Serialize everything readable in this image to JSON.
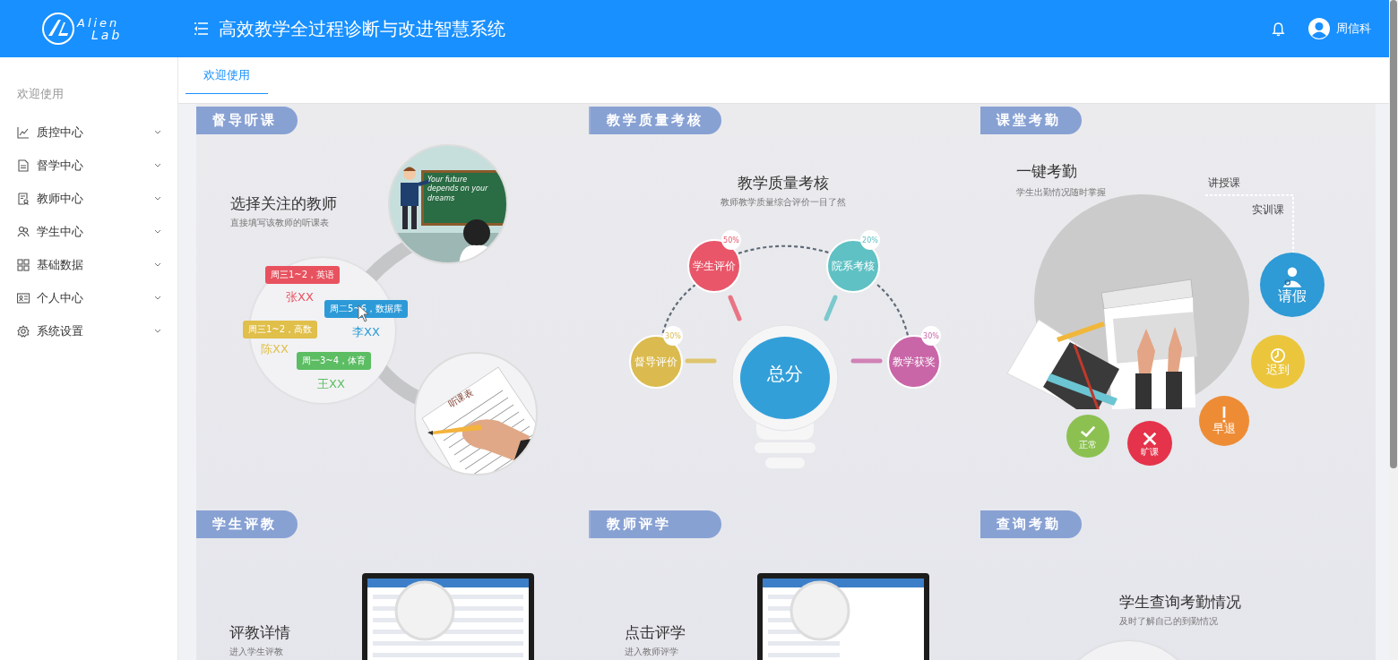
{
  "header": {
    "logo": [
      "Alien",
      "Lab"
    ],
    "title": "高效教学全过程诊断与改进智慧系统",
    "user": "周信科"
  },
  "sidebar": {
    "heading": "欢迎使用",
    "items": [
      {
        "label": "质控中心",
        "expanded": false
      },
      {
        "label": "督学中心",
        "expanded": false
      },
      {
        "label": "教师中心",
        "expanded": false
      },
      {
        "label": "学生中心",
        "expanded": false
      },
      {
        "label": "基础数据",
        "expanded": false
      },
      {
        "label": "个人中心",
        "expanded": false
      },
      {
        "label": "系统设置",
        "expanded": false
      }
    ]
  },
  "tabs": [
    {
      "label": "欢迎使用",
      "selected": true
    }
  ],
  "panels": [
    {
      "kind": "supervision",
      "tag": "督导听课",
      "title": "选择关注的教师",
      "subtitle": "直接填写该教师的听课表",
      "board_text": "Your future depends on your dreams",
      "sheet_title": "听课表",
      "bubbles": [
        {
          "text": "周三1~2，英语",
          "name": "张XX",
          "color": "#e8525f"
        },
        {
          "text": "周二5~6，数据库",
          "name": "李XX",
          "color": "#2d9ad8"
        },
        {
          "text": "周三1~2，高数",
          "name": "陈XX",
          "color": "#e0bf4a"
        },
        {
          "text": "周一3~4，体育",
          "name": "王XX",
          "color": "#5cbd63"
        }
      ]
    },
    {
      "kind": "quality",
      "tag": "教学质量考核",
      "title": "教学质量考核",
      "subtitle": "教师教学质量综合评价一目了然",
      "center": "总分",
      "nodes": [
        {
          "label": "学生评价",
          "share": "50%",
          "color": "#e9566a"
        },
        {
          "label": "院系考核",
          "share": "20%",
          "color": "#5fc1c4"
        },
        {
          "label": "督导评价",
          "share": "30%",
          "color": "#dbbb4f"
        },
        {
          "label": "教学获奖",
          "share": "30%",
          "color": "#c966a8"
        }
      ]
    },
    {
      "kind": "attendance",
      "tag": "课堂考勤",
      "title": "一键考勤",
      "subtitle": "学生出勤情况随时掌握",
      "course_types": [
        "讲授课",
        "实训课"
      ],
      "statuses": [
        {
          "label": "请假",
          "color": "#2e9ad6"
        },
        {
          "label": "迟到",
          "color": "#ebc63c"
        },
        {
          "label": "早退",
          "color": "#ee8c35"
        },
        {
          "label": "旷课",
          "color": "#e4334a"
        },
        {
          "label": "正常",
          "color": "#8cc152"
        }
      ]
    },
    {
      "kind": "screen",
      "tag": "学生评教",
      "title": "评教详情",
      "subtitle": "进入学生评教"
    },
    {
      "kind": "screen",
      "tag": "教师评学",
      "title": "点击评学",
      "subtitle": "进入教师评学"
    },
    {
      "kind": "query",
      "tag": "查询考勤",
      "title": "学生查询考勤情况",
      "subtitle": "及时了解自己的到勤情况"
    }
  ]
}
